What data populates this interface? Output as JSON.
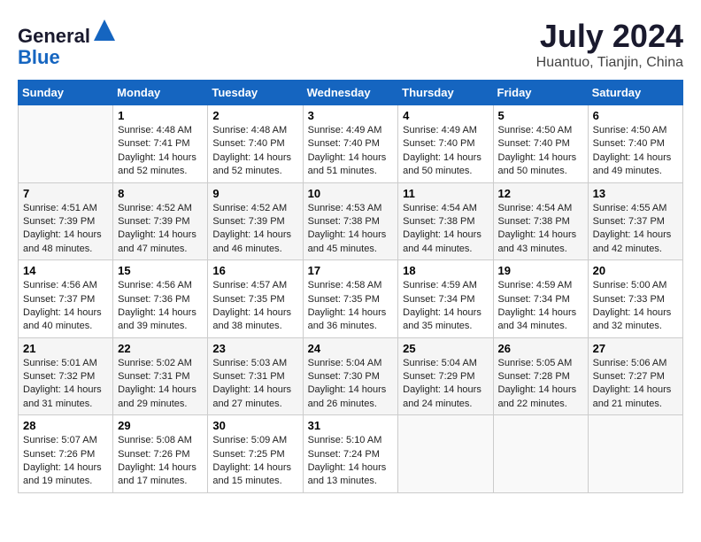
{
  "header": {
    "logo_general": "General",
    "logo_blue": "Blue",
    "month_year": "July 2024",
    "location": "Huantuo, Tianjin, China"
  },
  "weekdays": [
    "Sunday",
    "Monday",
    "Tuesday",
    "Wednesday",
    "Thursday",
    "Friday",
    "Saturday"
  ],
  "weeks": [
    [
      {
        "day": "",
        "info": ""
      },
      {
        "day": "1",
        "info": "Sunrise: 4:48 AM\nSunset: 7:41 PM\nDaylight: 14 hours\nand 52 minutes."
      },
      {
        "day": "2",
        "info": "Sunrise: 4:48 AM\nSunset: 7:40 PM\nDaylight: 14 hours\nand 52 minutes."
      },
      {
        "day": "3",
        "info": "Sunrise: 4:49 AM\nSunset: 7:40 PM\nDaylight: 14 hours\nand 51 minutes."
      },
      {
        "day": "4",
        "info": "Sunrise: 4:49 AM\nSunset: 7:40 PM\nDaylight: 14 hours\nand 50 minutes."
      },
      {
        "day": "5",
        "info": "Sunrise: 4:50 AM\nSunset: 7:40 PM\nDaylight: 14 hours\nand 50 minutes."
      },
      {
        "day": "6",
        "info": "Sunrise: 4:50 AM\nSunset: 7:40 PM\nDaylight: 14 hours\nand 49 minutes."
      }
    ],
    [
      {
        "day": "7",
        "info": "Sunrise: 4:51 AM\nSunset: 7:39 PM\nDaylight: 14 hours\nand 48 minutes."
      },
      {
        "day": "8",
        "info": "Sunrise: 4:52 AM\nSunset: 7:39 PM\nDaylight: 14 hours\nand 47 minutes."
      },
      {
        "day": "9",
        "info": "Sunrise: 4:52 AM\nSunset: 7:39 PM\nDaylight: 14 hours\nand 46 minutes."
      },
      {
        "day": "10",
        "info": "Sunrise: 4:53 AM\nSunset: 7:38 PM\nDaylight: 14 hours\nand 45 minutes."
      },
      {
        "day": "11",
        "info": "Sunrise: 4:54 AM\nSunset: 7:38 PM\nDaylight: 14 hours\nand 44 minutes."
      },
      {
        "day": "12",
        "info": "Sunrise: 4:54 AM\nSunset: 7:38 PM\nDaylight: 14 hours\nand 43 minutes."
      },
      {
        "day": "13",
        "info": "Sunrise: 4:55 AM\nSunset: 7:37 PM\nDaylight: 14 hours\nand 42 minutes."
      }
    ],
    [
      {
        "day": "14",
        "info": "Sunrise: 4:56 AM\nSunset: 7:37 PM\nDaylight: 14 hours\nand 40 minutes."
      },
      {
        "day": "15",
        "info": "Sunrise: 4:56 AM\nSunset: 7:36 PM\nDaylight: 14 hours\nand 39 minutes."
      },
      {
        "day": "16",
        "info": "Sunrise: 4:57 AM\nSunset: 7:35 PM\nDaylight: 14 hours\nand 38 minutes."
      },
      {
        "day": "17",
        "info": "Sunrise: 4:58 AM\nSunset: 7:35 PM\nDaylight: 14 hours\nand 36 minutes."
      },
      {
        "day": "18",
        "info": "Sunrise: 4:59 AM\nSunset: 7:34 PM\nDaylight: 14 hours\nand 35 minutes."
      },
      {
        "day": "19",
        "info": "Sunrise: 4:59 AM\nSunset: 7:34 PM\nDaylight: 14 hours\nand 34 minutes."
      },
      {
        "day": "20",
        "info": "Sunrise: 5:00 AM\nSunset: 7:33 PM\nDaylight: 14 hours\nand 32 minutes."
      }
    ],
    [
      {
        "day": "21",
        "info": "Sunrise: 5:01 AM\nSunset: 7:32 PM\nDaylight: 14 hours\nand 31 minutes."
      },
      {
        "day": "22",
        "info": "Sunrise: 5:02 AM\nSunset: 7:31 PM\nDaylight: 14 hours\nand 29 minutes."
      },
      {
        "day": "23",
        "info": "Sunrise: 5:03 AM\nSunset: 7:31 PM\nDaylight: 14 hours\nand 27 minutes."
      },
      {
        "day": "24",
        "info": "Sunrise: 5:04 AM\nSunset: 7:30 PM\nDaylight: 14 hours\nand 26 minutes."
      },
      {
        "day": "25",
        "info": "Sunrise: 5:04 AM\nSunset: 7:29 PM\nDaylight: 14 hours\nand 24 minutes."
      },
      {
        "day": "26",
        "info": "Sunrise: 5:05 AM\nSunset: 7:28 PM\nDaylight: 14 hours\nand 22 minutes."
      },
      {
        "day": "27",
        "info": "Sunrise: 5:06 AM\nSunset: 7:27 PM\nDaylight: 14 hours\nand 21 minutes."
      }
    ],
    [
      {
        "day": "28",
        "info": "Sunrise: 5:07 AM\nSunset: 7:26 PM\nDaylight: 14 hours\nand 19 minutes."
      },
      {
        "day": "29",
        "info": "Sunrise: 5:08 AM\nSunset: 7:26 PM\nDaylight: 14 hours\nand 17 minutes."
      },
      {
        "day": "30",
        "info": "Sunrise: 5:09 AM\nSunset: 7:25 PM\nDaylight: 14 hours\nand 15 minutes."
      },
      {
        "day": "31",
        "info": "Sunrise: 5:10 AM\nSunset: 7:24 PM\nDaylight: 14 hours\nand 13 minutes."
      },
      {
        "day": "",
        "info": ""
      },
      {
        "day": "",
        "info": ""
      },
      {
        "day": "",
        "info": ""
      }
    ]
  ]
}
